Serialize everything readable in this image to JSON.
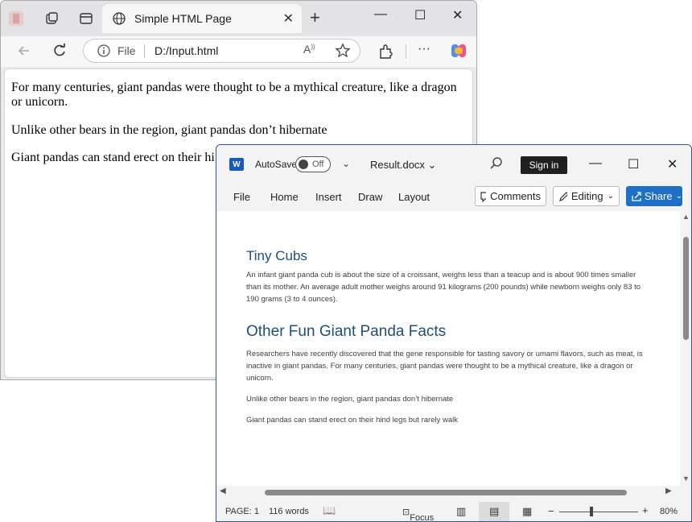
{
  "browser": {
    "tab_title": "Simple HTML Page",
    "address_scheme": "File",
    "address_url": "D:/Input.html",
    "paragraphs": [
      "For many centuries, giant pandas were thought to be a mythical creature, like a dragon or unicorn.",
      "Unlike other bears in the region, giant pandas don’t hibernate",
      "Giant pandas can stand erect on their hi"
    ]
  },
  "word": {
    "logo": "W",
    "autosave_label": "AutoSave",
    "autosave_state": "Off",
    "doc_name": "Result.docx",
    "signin_label": "Sign in",
    "ribbon_tabs": [
      "File",
      "Home",
      "Insert",
      "Draw",
      "Layout"
    ],
    "comments_label": "Comments",
    "editing_label": "Editing",
    "share_label": "Share",
    "heading1": "Tiny Cubs",
    "para1": "An infant giant panda cub is about the size of a croissant, weighs less than a teacup and is about 900 times smaller than its mother. An average adult mother weighs around 91 kilograms (200 pounds) while newborn weighs only 83 to 190 grams (3 to 4 ounces).",
    "heading2": "Other Fun Giant Panda Facts",
    "para2": "Researchers have recently discovered that the gene responsible for tasting savory or umami flavors, such as meat, is inactive in giant pandas. For many centuries, giant pandas were thought to be a mythical creature, like a dragon or unicorn.",
    "para3": "Unlike other bears in the region, giant pandas don’t hibernate",
    "para4": "Giant pandas can stand erect on their hind legs but rarely walk",
    "status_page": "PAGE: 1",
    "status_words": "116 words",
    "status_focus": "Focus",
    "zoom": "80%"
  }
}
